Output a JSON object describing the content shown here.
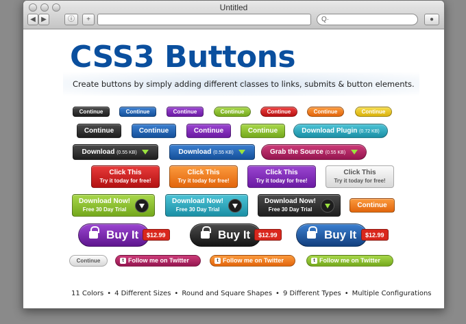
{
  "window": {
    "title": "Untitled",
    "search_glyph": "Q·"
  },
  "page": {
    "headline": "CSS3 Buttons",
    "subline": "Create buttons by simply adding different classes to links, submits & button elements."
  },
  "colors": {
    "black": "#2b2b2b",
    "blue": "#1f5fae",
    "purple": "#7a22b3",
    "green": "#86b82a",
    "red": "#d42020",
    "orange": "#f07a1a",
    "yellow": "#e8c71e",
    "teal": "#27a8bf",
    "magenta": "#b0215e",
    "gray": "#e9e9e9"
  },
  "row1": [
    "Continue",
    "Continue",
    "Continue",
    "Continue",
    "Continue",
    "Continue",
    "Continue"
  ],
  "row2": {
    "continue": [
      "Continue",
      "Continue",
      "Continue",
      "Continue"
    ],
    "plugin": "Download Plugin",
    "plugin_size": "(0.72 KB)"
  },
  "row3": [
    {
      "label": "Download",
      "size": "(0.55 KB)"
    },
    {
      "label": "Download",
      "size": "(0.55 KB)"
    },
    {
      "label": "Grab the Source",
      "size": "(0.55 KB)"
    }
  ],
  "row4": {
    "line1": "Click This",
    "line2": "Try it today for free!"
  },
  "row5": {
    "line1": "Download Now!",
    "line2": "Free 30 Day Trial",
    "continue": "Continue"
  },
  "row6": {
    "label": "Buy It",
    "price": "$12.99"
  },
  "row7": {
    "continue": "Continue",
    "follow": "Follow me on Twitter",
    "twitter_glyph": "t"
  },
  "features": [
    "11 Colors",
    "4 Different Sizes",
    "Round and Square Shapes",
    "9 Different Types",
    "Multiple Configurations"
  ],
  "bullet": "•"
}
